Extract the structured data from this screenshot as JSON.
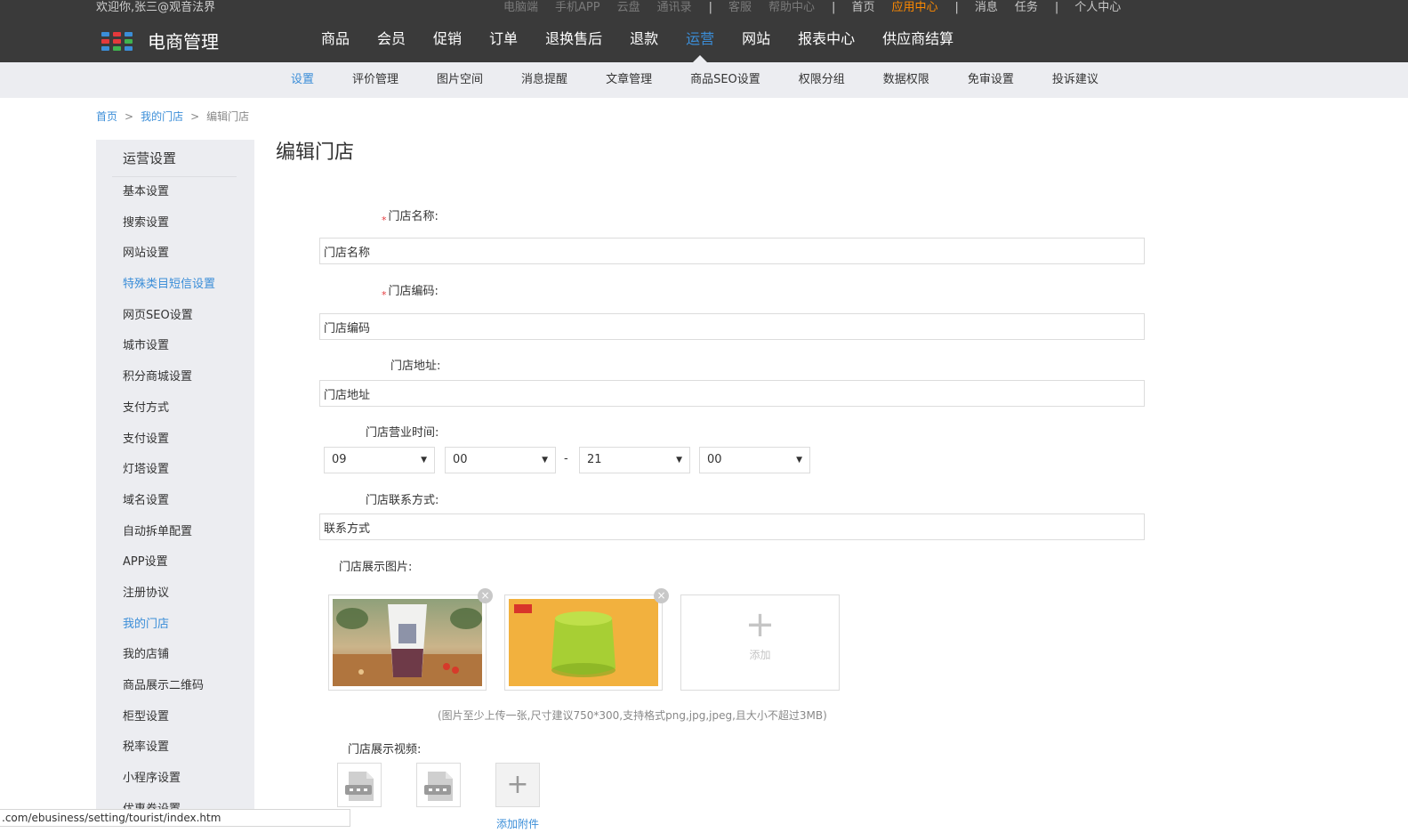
{
  "topbar": {
    "welcome": "欢迎你,张三@观音法界",
    "links": [
      {
        "label": "电脑端",
        "style": "dim"
      },
      {
        "label": "手机APP",
        "style": "dim"
      },
      {
        "label": "云盘",
        "style": "dim"
      },
      {
        "label": "通讯录",
        "style": "dim"
      },
      {
        "label": "|",
        "style": "sep"
      },
      {
        "label": "客服",
        "style": "dim"
      },
      {
        "label": "帮助中心",
        "style": "dim"
      },
      {
        "label": "|",
        "style": "sep"
      },
      {
        "label": "首页",
        "style": "lt"
      },
      {
        "label": "应用中心",
        "style": "active"
      },
      {
        "label": "|",
        "style": "sep"
      },
      {
        "label": "消息",
        "style": "lt"
      },
      {
        "label": "任务",
        "style": "lt"
      },
      {
        "label": "|",
        "style": "sep"
      },
      {
        "label": "个人中心",
        "style": "lt"
      }
    ]
  },
  "brand": {
    "name": "电商管理",
    "icon": "grid-logo-icon",
    "icon_colors": [
      "#3b8ed8",
      "#e4393c",
      "#f3a31b",
      "#3fb34f"
    ]
  },
  "mainnav": {
    "items": [
      "商品",
      "会员",
      "促销",
      "订单",
      "退换售后",
      "退款",
      "运营",
      "网站",
      "报表中心",
      "供应商结算"
    ],
    "active_index": 6
  },
  "subnav": {
    "items": [
      "设置",
      "评价管理",
      "图片空间",
      "消息提醒",
      "文章管理",
      "商品SEO设置",
      "权限分组",
      "数据权限",
      "免审设置",
      "投诉建议"
    ],
    "active_index": 0
  },
  "breadcrumb": {
    "home": "首页",
    "parent": "我的门店",
    "current": "编辑门店",
    "separator": ">"
  },
  "sidebar": {
    "title": "运营设置",
    "items": [
      {
        "label": "基本设置",
        "highlight": false
      },
      {
        "label": "搜索设置",
        "highlight": false
      },
      {
        "label": "网站设置",
        "highlight": false
      },
      {
        "label": "特殊类目短信设置",
        "highlight": true
      },
      {
        "label": "网页SEO设置",
        "highlight": false
      },
      {
        "label": "城市设置",
        "highlight": false
      },
      {
        "label": "积分商城设置",
        "highlight": false
      },
      {
        "label": "支付方式",
        "highlight": false
      },
      {
        "label": "支付设置",
        "highlight": false
      },
      {
        "label": "灯塔设置",
        "highlight": false
      },
      {
        "label": "域名设置",
        "highlight": false
      },
      {
        "label": "自动拆单配置",
        "highlight": false
      },
      {
        "label": "APP设置",
        "highlight": false
      },
      {
        "label": "注册协议",
        "highlight": false
      },
      {
        "label": "我的门店",
        "highlight": true
      },
      {
        "label": "我的店铺",
        "highlight": false
      },
      {
        "label": "商品展示二维码",
        "highlight": false
      },
      {
        "label": "柜型设置",
        "highlight": false
      },
      {
        "label": "税率设置",
        "highlight": false
      },
      {
        "label": "小程序设置",
        "highlight": false
      },
      {
        "label": "优惠券设置",
        "highlight": false
      }
    ]
  },
  "form": {
    "title": "编辑门店",
    "required_mark": "*",
    "store_name": {
      "label": "门店名称:",
      "value": "门店名称"
    },
    "store_code": {
      "label": "门店编码:",
      "value": "门店编码"
    },
    "store_address": {
      "label": "门店地址:",
      "value": "门店地址"
    },
    "business_hours": {
      "label": "门店营业时间:",
      "open_hour": "09",
      "open_minute": "00",
      "separator": "-",
      "close_hour": "21",
      "close_minute": "00"
    },
    "contact": {
      "label": "门店联系方式:",
      "value": "联系方式"
    },
    "images": {
      "label": "门店展示图片:",
      "remove_glyph": "×",
      "add_glyph": "+",
      "add_label": "添加",
      "hint": "(图片至少上传一张,尺寸建议750*300,支持格式png,jpg,jpeg,且大小不超过3MB)"
    },
    "videos": {
      "label": "门店展示视频:",
      "add_glyph": "+",
      "add_label": "添加附件"
    }
  },
  "statusbar": {
    "url": ".com/ebusiness/setting/tourist/index.htm"
  }
}
